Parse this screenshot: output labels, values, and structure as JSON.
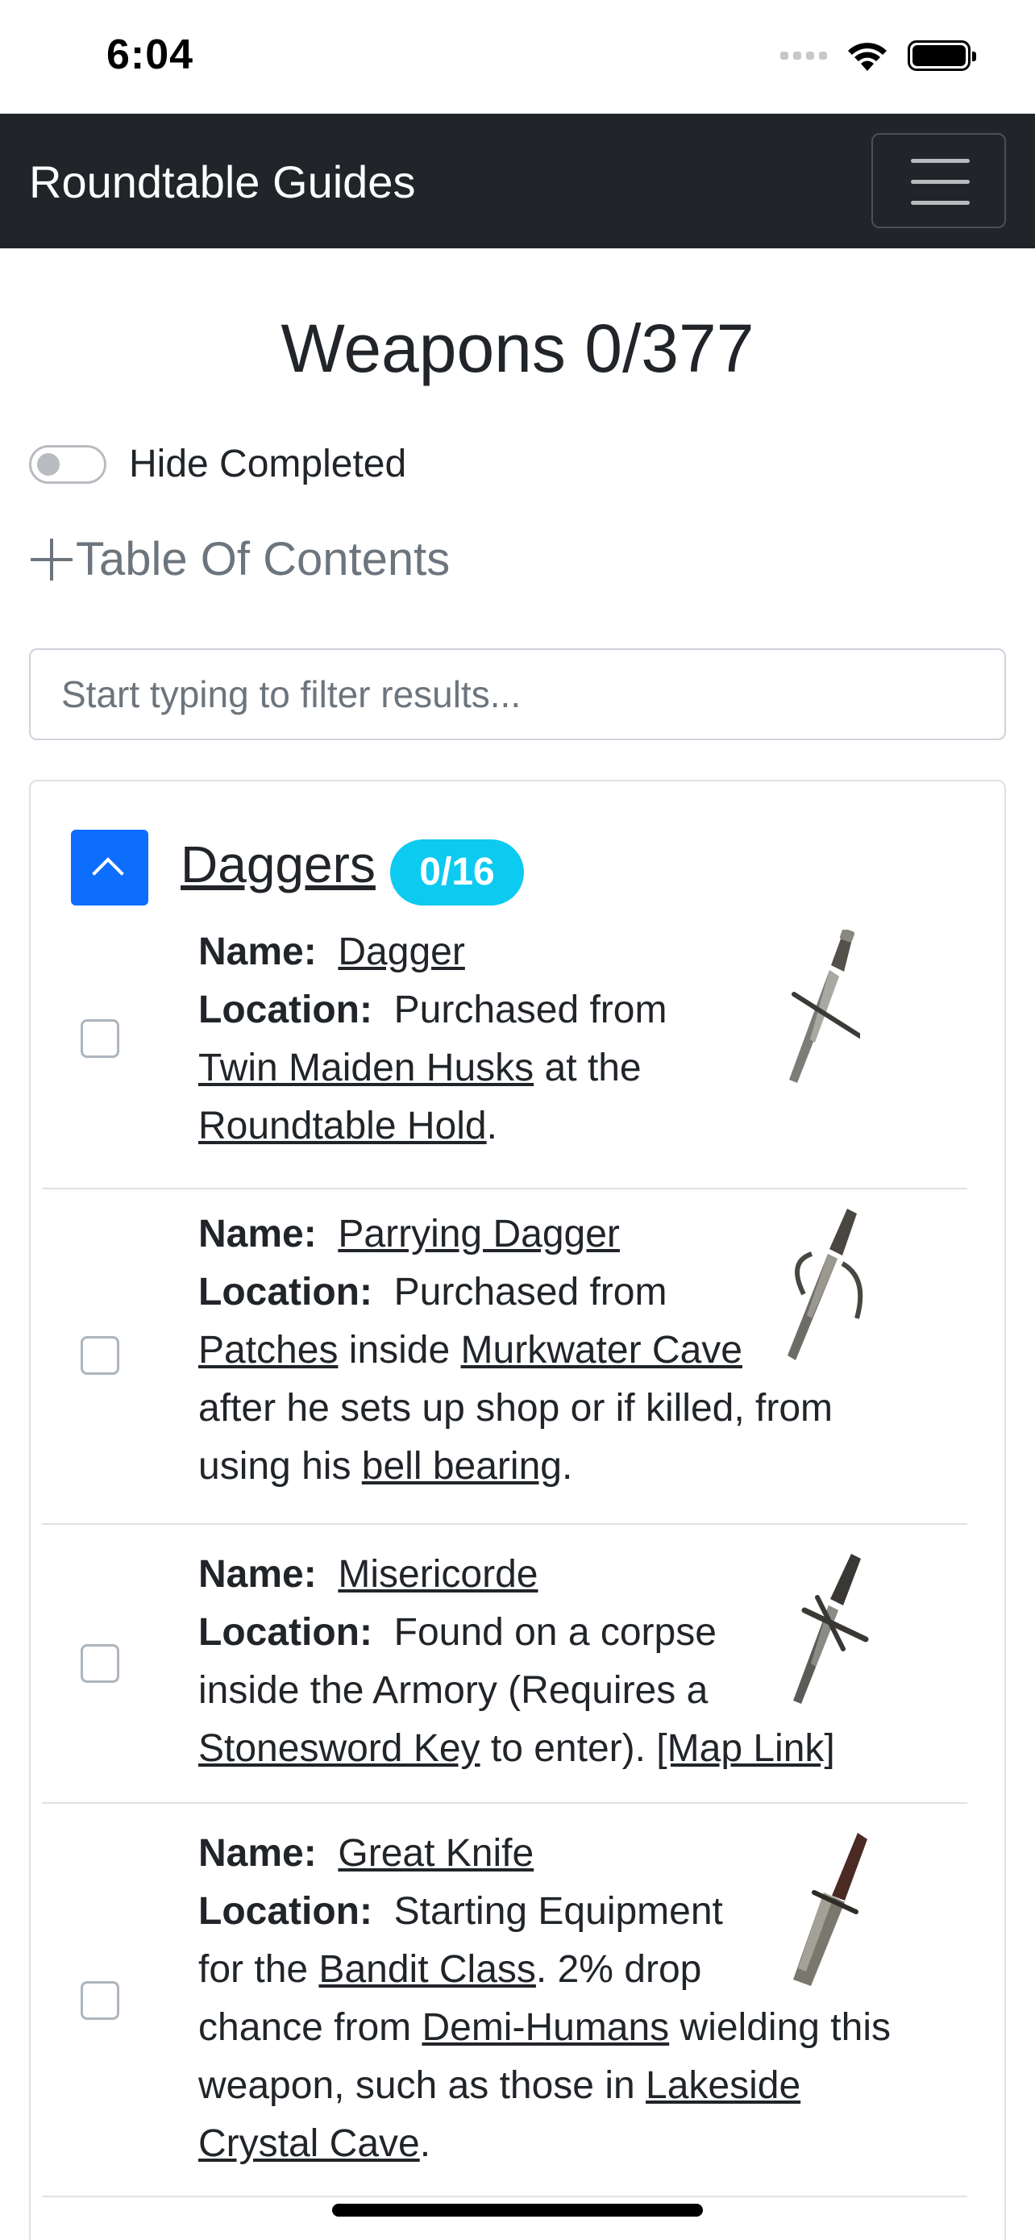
{
  "status": {
    "time": "6:04"
  },
  "navbar": {
    "brand": "Roundtable Guides"
  },
  "page": {
    "title": "Weapons 0/377"
  },
  "toggle": {
    "label": "Hide Completed",
    "on": false
  },
  "toc": {
    "label": "Table Of Contents"
  },
  "search": {
    "placeholder": "Start typing to filter results..."
  },
  "category": {
    "title": "Daggers",
    "badge": "0/16"
  },
  "labels": {
    "name": "Name:",
    "location": "Location:"
  },
  "items": [
    {
      "name": "Dagger",
      "loc_lines": [
        [
          "Purchased from"
        ],
        [
          "Twin Maiden Husks",
          " at the"
        ],
        [
          "Roundtable Hold",
          "."
        ]
      ]
    },
    {
      "name": "Parrying Dagger",
      "loc_lines": [
        [
          "Purchased from"
        ],
        [
          "Patches",
          " inside ",
          "Murkwater Cave"
        ],
        [
          "after he sets up shop or if killed, from"
        ],
        [
          "using his ",
          "bell bearing",
          "."
        ]
      ]
    },
    {
      "name": "Misericorde",
      "loc_lines": [
        [
          "Found on a corpse"
        ],
        [
          "inside the Armory (Requires a"
        ],
        [
          "Stonesword Key",
          " to enter). ",
          "[Map Link]"
        ]
      ]
    },
    {
      "name": "Great Knife",
      "loc_lines": [
        [
          "Starting Equipment"
        ],
        [
          "for the ",
          "Bandit Class",
          ". 2% drop"
        ],
        [
          "chance from ",
          "Demi-Humans",
          " wielding this"
        ],
        [
          "weapon, such as those in ",
          "Lakeside"
        ],
        [
          "Crystal Cave",
          "."
        ]
      ]
    }
  ],
  "colors": {
    "navbar": "#212529",
    "primary": "#0d6efd",
    "badge": "#0dcaf0",
    "muted": "#6c757d"
  }
}
